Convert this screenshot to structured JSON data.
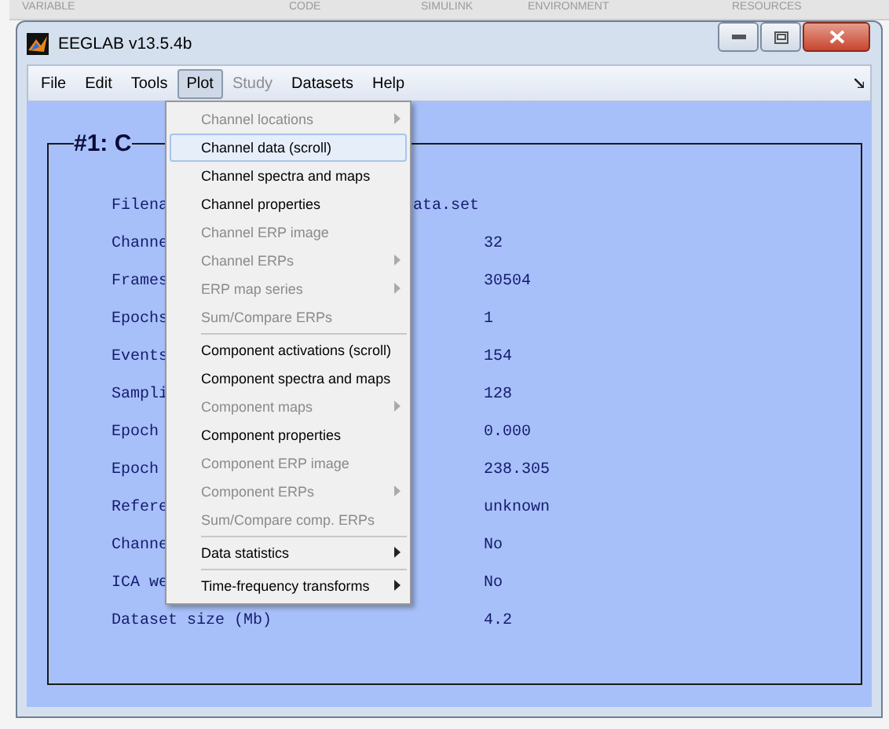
{
  "background_toolstrip": {
    "sections": [
      "VARIABLE",
      "CODE",
      "SIMULINK",
      "ENVIRONMENT",
      "RESOURCES"
    ]
  },
  "window": {
    "title": "EEGLAB v13.5.4b"
  },
  "menubar": [
    {
      "label": "File",
      "selected": false,
      "disabled": false
    },
    {
      "label": "Edit",
      "selected": false,
      "disabled": false
    },
    {
      "label": "Tools",
      "selected": false,
      "disabled": false
    },
    {
      "label": "Plot",
      "selected": true,
      "disabled": false
    },
    {
      "label": "Study",
      "selected": false,
      "disabled": true
    },
    {
      "label": "Datasets",
      "selected": false,
      "disabled": false
    },
    {
      "label": "Help",
      "selected": false,
      "disabled": false
    }
  ],
  "dataset_panel": {
    "heading": "#1: C",
    "rows": [
      {
        "label": "Filena",
        "label_end": "ata.set"
      },
      {
        "label": "Channe",
        "value": "32"
      },
      {
        "label": "Frames",
        "value": "30504"
      },
      {
        "label": "Epochs",
        "value": "1"
      },
      {
        "label": "Events",
        "value": "154"
      },
      {
        "label": "Sampli",
        "value": "128"
      },
      {
        "label": "Epoch",
        "value": "0.000"
      },
      {
        "label": "Epoch",
        "value": "238.305"
      },
      {
        "label": "Refere",
        "value": "unknown"
      },
      {
        "label": "Channe",
        "value": "No"
      },
      {
        "label": "ICA we",
        "value": "No"
      },
      {
        "label": "Dataset size (Mb)",
        "value": "4.2"
      }
    ]
  },
  "plot_menu": [
    {
      "kind": "item",
      "label": "Channel locations",
      "disabled": true,
      "submenu": true,
      "selected": false
    },
    {
      "kind": "item",
      "label": "Channel data (scroll)",
      "disabled": false,
      "submenu": false,
      "selected": true
    },
    {
      "kind": "item",
      "label": "Channel spectra and maps",
      "disabled": false,
      "submenu": false,
      "selected": false
    },
    {
      "kind": "item",
      "label": "Channel properties",
      "disabled": false,
      "submenu": false,
      "selected": false
    },
    {
      "kind": "item",
      "label": "Channel ERP image",
      "disabled": true,
      "submenu": false,
      "selected": false
    },
    {
      "kind": "item",
      "label": "Channel ERPs",
      "disabled": true,
      "submenu": true,
      "selected": false
    },
    {
      "kind": "item",
      "label": "ERP map series",
      "disabled": true,
      "submenu": true,
      "selected": false
    },
    {
      "kind": "item",
      "label": "Sum/Compare ERPs",
      "disabled": true,
      "submenu": false,
      "selected": false
    },
    {
      "kind": "separator"
    },
    {
      "kind": "item",
      "label": "Component activations (scroll)",
      "disabled": false,
      "submenu": false,
      "selected": false
    },
    {
      "kind": "item",
      "label": "Component spectra and maps",
      "disabled": false,
      "submenu": false,
      "selected": false
    },
    {
      "kind": "item",
      "label": "Component maps",
      "disabled": true,
      "submenu": true,
      "selected": false
    },
    {
      "kind": "item",
      "label": "Component properties",
      "disabled": false,
      "submenu": false,
      "selected": false
    },
    {
      "kind": "item",
      "label": "Component ERP image",
      "disabled": true,
      "submenu": false,
      "selected": false
    },
    {
      "kind": "item",
      "label": "Component ERPs",
      "disabled": true,
      "submenu": true,
      "selected": false
    },
    {
      "kind": "item",
      "label": "Sum/Compare comp. ERPs",
      "disabled": true,
      "submenu": false,
      "selected": false
    },
    {
      "kind": "separator"
    },
    {
      "kind": "item",
      "label": "Data statistics",
      "disabled": false,
      "submenu": true,
      "selected": false
    },
    {
      "kind": "separator"
    },
    {
      "kind": "item",
      "label": "Time-frequency transforms",
      "disabled": false,
      "submenu": true,
      "selected": false
    }
  ]
}
